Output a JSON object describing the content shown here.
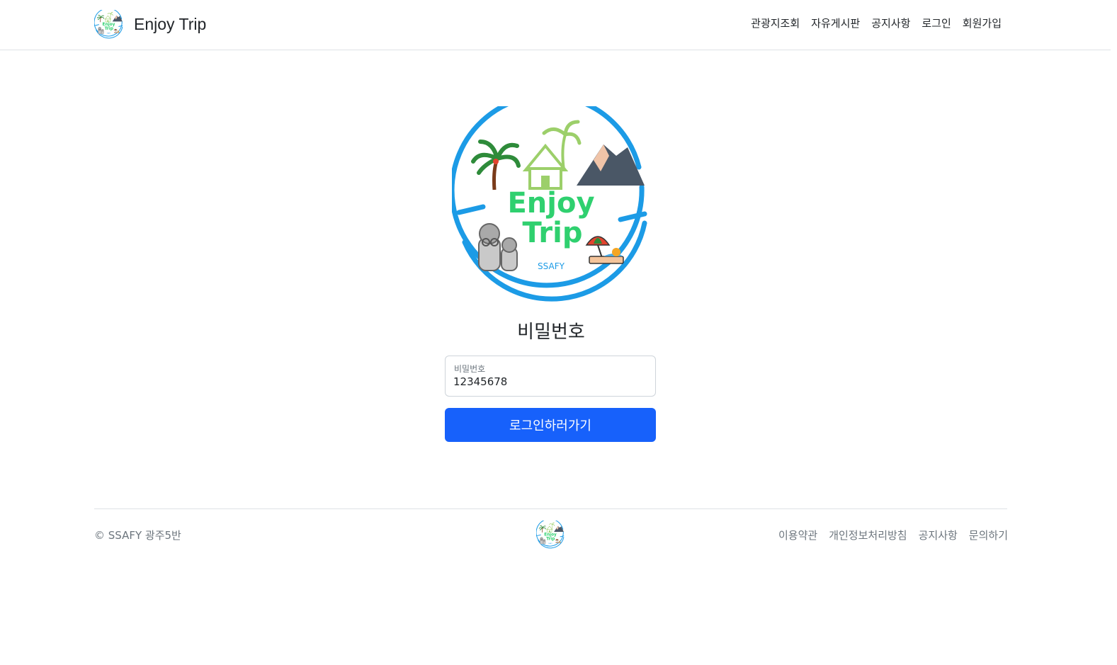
{
  "brand": {
    "name": "Enjoy Trip",
    "logo_icon": "enjoy-trip-logo-icon"
  },
  "nav": {
    "items": [
      "관광지조회",
      "자유게시판",
      "공지사항",
      "로그인",
      "회원가입"
    ]
  },
  "logo": {
    "line1": "Enjoy",
    "line2": "Trip",
    "subtitle": "SSAFY"
  },
  "page": {
    "title": "비밀번호"
  },
  "password_field": {
    "label": "비밀번호",
    "value": "12345678"
  },
  "login_button": {
    "label": "로그인하러가기"
  },
  "footer": {
    "copyright": "© SSAFY 광주5반",
    "links": [
      "이용약관",
      "개인정보처리방침",
      "공지사항",
      "문의하기"
    ]
  },
  "colors": {
    "primary": "#1761fb",
    "logo_ring": "#1c9be6",
    "logo_text": "#2fd06f"
  }
}
